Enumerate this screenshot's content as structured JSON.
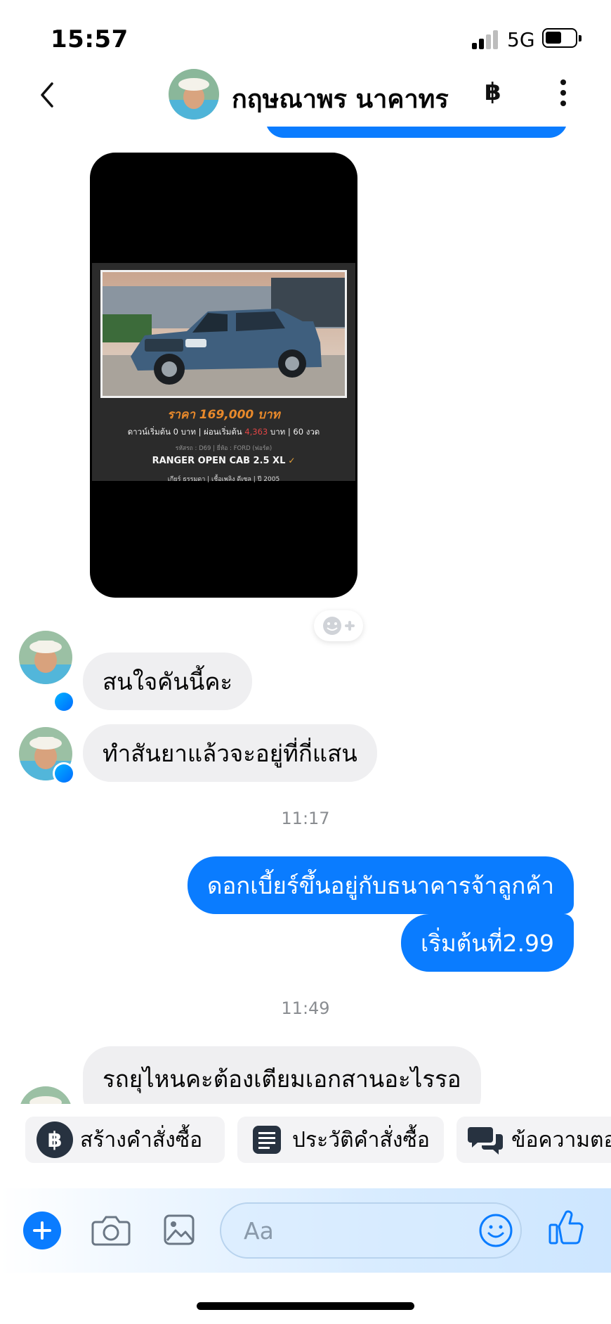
{
  "status_bar": {
    "time": "15:57",
    "network": "5G"
  },
  "header": {
    "contact_name": "กฤษณาพร นาคาทร",
    "payment_icon": "฿"
  },
  "listing_card": {
    "price": "ราคา 169,000 บาท",
    "terms_prefix": "ดาวน์เริ่มต้น 0 บาท | ผ่อนเริ่มต้น ",
    "terms_highlight": "4,363",
    "terms_suffix": " บาท | 60 งวด",
    "meta": "รหัสรถ : D69 | ยี่ห้อ : FORD (ฟอร์ด)",
    "model": "RANGER OPEN CAB 2.5 XL",
    "specs": "เกียร์ ธรรมดา  |  เชื้อเพลิง ดีเซล  |  ปี 2005"
  },
  "messages": [
    {
      "direction": "in",
      "text": "สนใจคันนี้คะ"
    },
    {
      "direction": "in",
      "text": "ทำสันยาแล้วจะอยู่ที่กี่แสน"
    },
    {
      "type": "timestamp",
      "text": "11:17"
    },
    {
      "direction": "out",
      "text": "ดอกเบี้ยร์ขึ้นอยู่กับธนาคารจ้าลูกค้า"
    },
    {
      "direction": "out",
      "text": "เริ่มต้นที่2.99"
    },
    {
      "type": "timestamp",
      "text": "11:49"
    },
    {
      "direction": "in",
      "text": "รถยุไหนคะต้องเตียมเอกสานอะไรรอ"
    }
  ],
  "quick_actions": [
    {
      "label": "สร้างคำสั่งซื้อ",
      "icon": "baht-circle-icon"
    },
    {
      "label": "ประวัติคำสั่งซื้อ",
      "icon": "receipt-icon"
    },
    {
      "label": "ข้อความตอ",
      "icon": "chat-bubbles-icon"
    }
  ],
  "composer": {
    "placeholder": "Aa"
  },
  "colors": {
    "messenger_blue": "#0a7cff",
    "incoming_bubble": "#efeff1",
    "timestamp_gray": "#8a8d91",
    "price_orange": "#e8892b"
  }
}
